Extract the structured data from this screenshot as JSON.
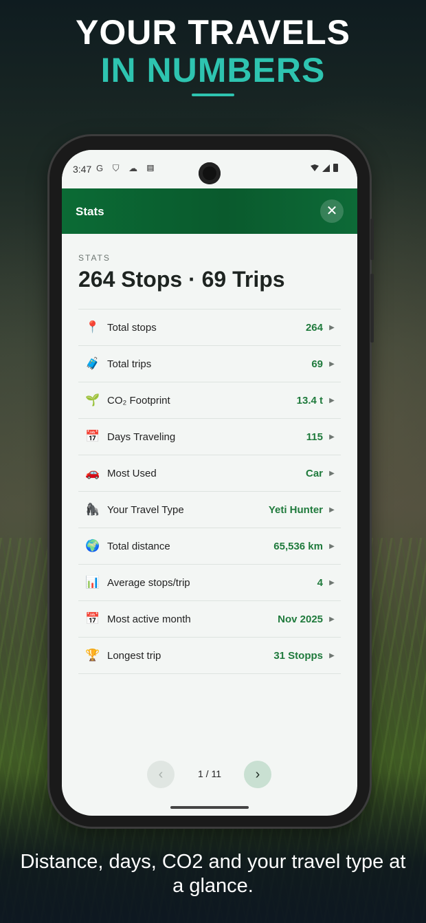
{
  "headline": {
    "line1": "YOUR TRAVELS",
    "line2": "IN NUMBERS"
  },
  "caption": "Distance, days, CO2 and your travel type at a glance.",
  "statusbar": {
    "time": "3:47",
    "left_icons": "G ⛉ ☁ ▤"
  },
  "appbar": {
    "title": "Stats",
    "close": "✕"
  },
  "section": {
    "overline": "STATS",
    "summary": "264 Stops · 69 Trips"
  },
  "rows": [
    {
      "icon": "📍",
      "icon_name": "pin-icon",
      "label": "Total stops",
      "value": "264"
    },
    {
      "icon": "🧳",
      "icon_name": "luggage-icon",
      "label": "Total trips",
      "value": "69"
    },
    {
      "icon": "🌱",
      "icon_name": "seedling-icon",
      "label": "CO₂ Footprint",
      "value": "13.4 t"
    },
    {
      "icon": "📅",
      "icon_name": "calendar-icon",
      "label": "Days Traveling",
      "value": "115"
    },
    {
      "icon": "🚗",
      "icon_name": "car-icon",
      "label": "Most Used",
      "value": "Car"
    },
    {
      "icon": "🦍",
      "icon_name": "yeti-icon",
      "label": "Your Travel Type",
      "value": "Yeti Hunter"
    },
    {
      "icon": "🌍",
      "icon_name": "globe-icon",
      "label": "Total distance",
      "value": "65,536 km"
    },
    {
      "icon": "📊",
      "icon_name": "bar-chart-icon",
      "label": "Average stops/trip",
      "value": "4"
    },
    {
      "icon": "📅",
      "icon_name": "calendar-icon",
      "label": "Most active month",
      "value": "Nov 2025"
    },
    {
      "icon": "🏆",
      "icon_name": "trophy-icon",
      "label": "Longest trip",
      "value": "31 Stopps"
    }
  ],
  "pager": {
    "prev": "‹",
    "next": "›",
    "count": "1 / 11"
  },
  "colors": {
    "accent": "#2ec4b0",
    "appbar": "#0b6b35",
    "value_green": "#1f7a3c"
  }
}
